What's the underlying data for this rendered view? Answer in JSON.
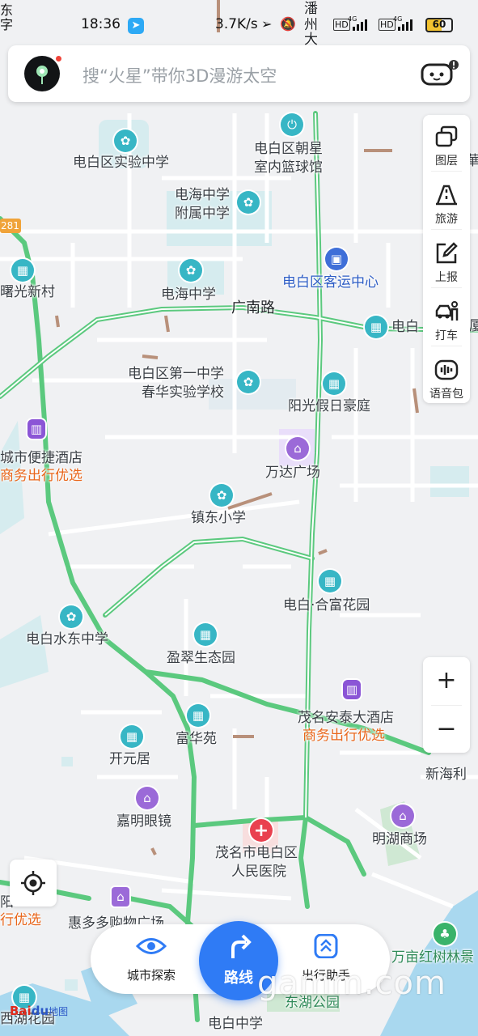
{
  "status_bar": {
    "time": "18:36",
    "speed": "3.7K/s",
    "battery": "60",
    "left_cut": "东\n字"
  },
  "search": {
    "placeholder": "搜“火星”带你3D漫游太空"
  },
  "toolbar": {
    "layers": "图层",
    "travel": "旅游",
    "report": "上报",
    "taxi": "打车",
    "voice": "语音包"
  },
  "zoom": {
    "in": "+",
    "out": "−"
  },
  "bottom_bar": {
    "explore": "城市探索",
    "route": "路线",
    "assistant": "出行助手"
  },
  "map_labels": {
    "shiyan": "电白区实验中学",
    "chaoxing_1": "电白区朝星",
    "chaoxing_2": "室内篮球馆",
    "fushu_1": "电海中学",
    "fushu_2": "附属中学",
    "shuguang": "曙光新村",
    "dianhai": "电海中学",
    "guangnan": "广南路",
    "keyun": "电白区客运中心",
    "dianbai_cut": "电白",
    "diyi_1": "电白区第一中学",
    "diyi_2": "春华实验学校",
    "yangguang": "阳光假日豪庭",
    "jiudian": "城市便捷酒店",
    "shangwu_left": "商务出行优选",
    "wanda": "万达广场",
    "zhendong": "镇东小学",
    "hefu": "电白·合富花园",
    "shuidong": "电白水东中学",
    "yingcui": "盈翠生态园",
    "antai": "茂名安泰大酒店",
    "shangwu_right": "商务出行优选",
    "fuhua": "富华苑",
    "kaiyuan": "开元居",
    "xinhaili": "新海利",
    "jiaming": "嘉明眼镜",
    "minghu": "明湖商场",
    "hospital_1": "茂名市电白区",
    "hospital_2": "人民医院",
    "left_yang": "阳",
    "left_you": "行优选",
    "huiduoduo": "惠多多购物广场",
    "wanmu": "万亩红树林景",
    "donghu": "东湖公园",
    "xihu": "西湖花园",
    "dianbai_middle": "电白中学",
    "road_281": "281",
    "panzhou_1": "潘",
    "panzhou_2": "州",
    "panzhou_3": "大",
    "right_cut": "華",
    "right_cut2": "厦"
  },
  "watermark": "gamm.com",
  "logo": {
    "bai": "Bai",
    "du": "du",
    "map": "地图"
  }
}
